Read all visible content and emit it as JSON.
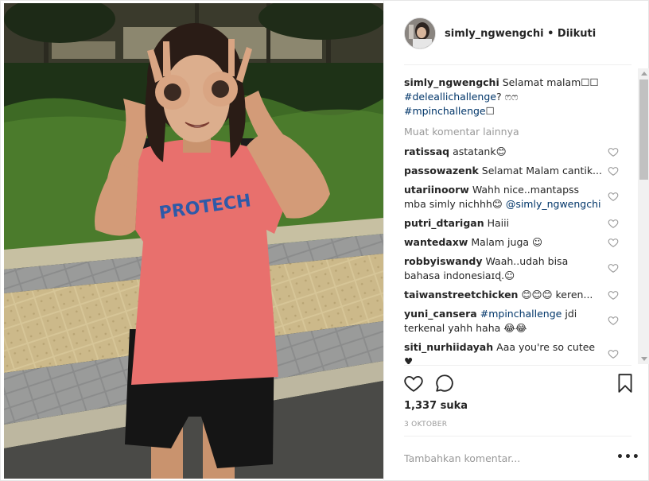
{
  "header": {
    "username": "simly_ngwengchi",
    "separator": "•",
    "follow_status": "Diikuti"
  },
  "caption": {
    "username": "simly_ngwengchi",
    "text": "Selamat malam☐☐",
    "hashtag1": "#deleallichallenge",
    "mid": "? ෆෆ",
    "hashtag2": "#mpinchallenge",
    "end": "☐"
  },
  "load_more": "Muat komentar lainnya",
  "comments": [
    {
      "user": "ratissaq",
      "text": "astatank😊"
    },
    {
      "user": "passowazenk",
      "text": "Selamat Malam cantik..."
    },
    {
      "user": "utariinoorw",
      "text": "Wahh nice..mantapss mba simly nichhh😊",
      "mention": "@simly_ngwengchi"
    },
    {
      "user": "putri_dtarigan",
      "text": "Haiii"
    },
    {
      "user": "wantedaxw",
      "text": "Malam juga ☺"
    },
    {
      "user": "robbyiswandy",
      "text": "Waah..udah bisa bahasa indonesiaɪɖ.☺"
    },
    {
      "user": "taiwanstreetchicken",
      "text": "😊😊😊 keren..."
    },
    {
      "user": "yuni_cansera",
      "hashtag": "#mpinchallenge",
      "text": "jdi terkenal yahh haha 😂😂"
    },
    {
      "user": "siti_nurhiidayah",
      "text": "Aaa you're so cutee ♥"
    }
  ],
  "likes": "1,337 suka",
  "date": "3 OKTOBER",
  "add_comment": {
    "placeholder": "Tambahkan komentar..."
  },
  "more_options": "•••",
  "icons": {
    "like": "heart-icon",
    "comment": "comment-icon",
    "save": "bookmark-icon",
    "comment_like": "heart-icon"
  },
  "colors": {
    "hashtag": "#003569",
    "muted": "#999999",
    "text": "#262626"
  }
}
